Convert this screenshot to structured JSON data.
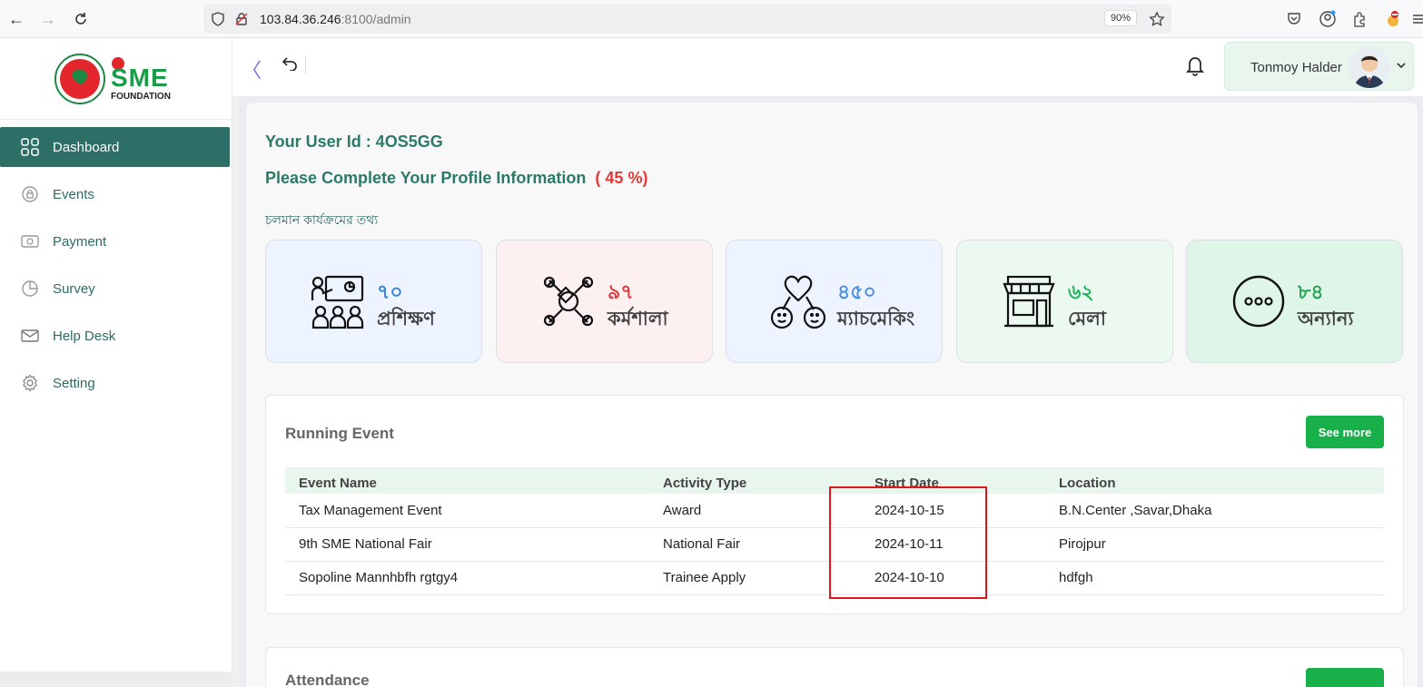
{
  "browser": {
    "url_host": "103.84.36.246",
    "url_rest": ":8100/admin",
    "zoom": "90%"
  },
  "brand": {
    "logo_letters": "SME",
    "logo_sub": "FOUNDATION"
  },
  "sidebar": {
    "items": [
      {
        "label": "Dashboard",
        "icon": "grid-icon"
      },
      {
        "label": "Events",
        "icon": "lock-icon"
      },
      {
        "label": "Payment",
        "icon": "cash-icon"
      },
      {
        "label": "Survey",
        "icon": "pie-chart-icon"
      },
      {
        "label": "Help Desk",
        "icon": "mail-icon"
      },
      {
        "label": "Setting",
        "icon": "gear-icon"
      }
    ]
  },
  "topbar": {
    "user_name": "Tonmoy Halder"
  },
  "dashboard": {
    "user_id_line": "Your User Id : 4OS5GG",
    "profile_prompt": "Please Complete Your Profile Information",
    "profile_pct": "( 45 %)",
    "section_heading": "চলমান কার্যক্রমের তথ্য"
  },
  "stats": [
    {
      "num": "৭০",
      "label": "প্রশিক্ষণ",
      "bg": "#eef4ff",
      "color": "#3b82d6"
    },
    {
      "num": "৯৭",
      "label": "কর্মশালা",
      "bg": "#fdf0f0",
      "color": "#e0393e"
    },
    {
      "num": "৪৫০",
      "label": "ম্যাচমেকিং",
      "bg": "#eef4ff",
      "color": "#4a90e2"
    },
    {
      "num": "৬২",
      "label": "মেলা",
      "bg": "#ebf9f1",
      "color": "#22b45e"
    },
    {
      "num": "৮৪",
      "label": "অন্যান্য",
      "bg": "#dff5e7",
      "color": "#22a455"
    }
  ],
  "running_event": {
    "title": "Running Event",
    "see_more": "See more",
    "columns": [
      "Event Name",
      "Activity Type",
      "Start Date",
      "Location"
    ],
    "rows": [
      [
        "Tax Management Event",
        "Award",
        "2024-10-15",
        "B.N.Center ,Savar,Dhaka"
      ],
      [
        "9th SME National Fair",
        "National Fair",
        "2024-10-11",
        "Pirojpur"
      ],
      [
        "Sopoline Mannhbfh rgtgy4",
        "Trainee Apply",
        "2024-10-10",
        "hdfgh"
      ]
    ]
  },
  "attendance": {
    "title": "Attendance"
  }
}
